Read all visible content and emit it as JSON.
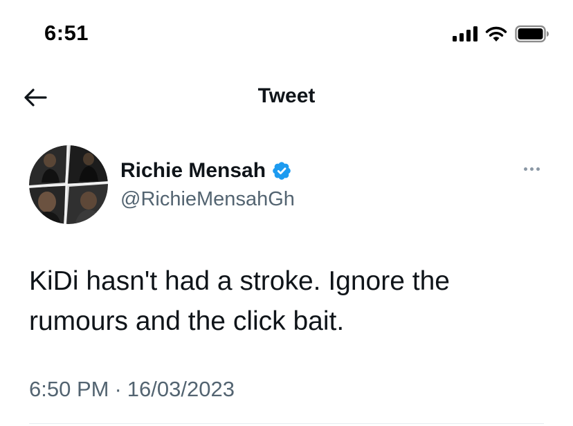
{
  "status_bar": {
    "time": "6:51",
    "icons": [
      "cellular-signal-icon",
      "wifi-icon",
      "battery-icon"
    ]
  },
  "header": {
    "back_icon": "arrow-left-icon",
    "title": "Tweet"
  },
  "author": {
    "name": "Richie Mensah",
    "handle": "@RichieMensahGh",
    "verified": true,
    "verified_color": "#1d9bf0"
  },
  "tweet": {
    "text": "KiDi hasn't had a stroke. Ignore the rumours and the click bait.",
    "time": "6:50 PM",
    "separator": "·",
    "date": "16/03/2023"
  },
  "colors": {
    "text_primary": "#0f1419",
    "text_secondary": "#536471",
    "accent": "#1d9bf0"
  }
}
